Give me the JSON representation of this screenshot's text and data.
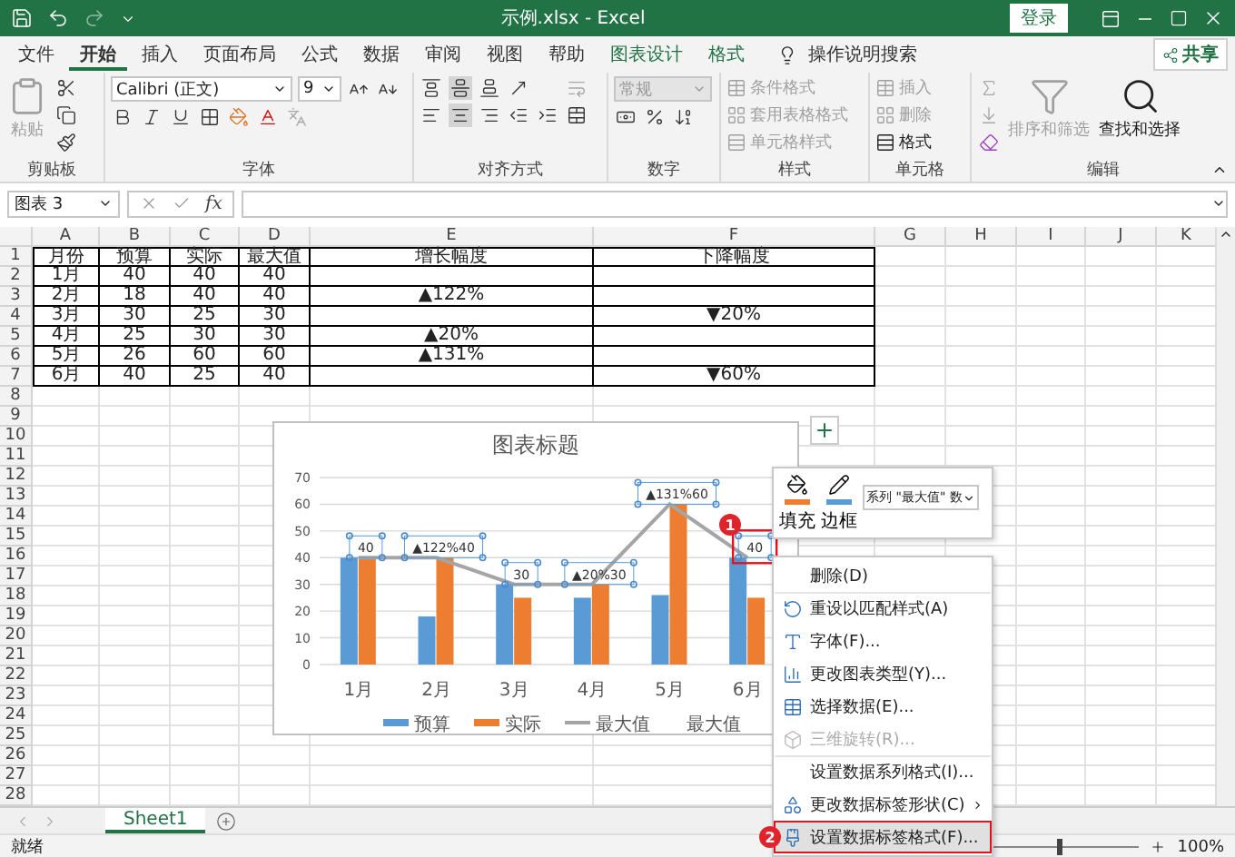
{
  "title_bar": {
    "title": "示例.xlsx - Excel",
    "login": "登录"
  },
  "menu_tabs": [
    {
      "label": "文件",
      "selected": false,
      "kind": "standard"
    },
    {
      "label": "开始",
      "selected": true,
      "kind": "standard"
    },
    {
      "label": "插入",
      "selected": false,
      "kind": "standard"
    },
    {
      "label": "页面布局",
      "selected": false,
      "kind": "standard"
    },
    {
      "label": "公式",
      "selected": false,
      "kind": "standard"
    },
    {
      "label": "数据",
      "selected": false,
      "kind": "standard"
    },
    {
      "label": "审阅",
      "selected": false,
      "kind": "standard"
    },
    {
      "label": "视图",
      "selected": false,
      "kind": "standard"
    },
    {
      "label": "帮助",
      "selected": false,
      "kind": "standard"
    },
    {
      "label": "图表设计",
      "selected": false,
      "kind": "contextual"
    },
    {
      "label": "格式",
      "selected": false,
      "kind": "contextual"
    }
  ],
  "tell_me": "操作说明搜索",
  "share": "共享",
  "ribbon": [
    {
      "label": "剪贴板",
      "kind": "clipboard",
      "paste": "粘贴"
    },
    {
      "label": "字体",
      "kind": "font",
      "font": "Calibri (正文)",
      "size": "9"
    },
    {
      "label": "对齐方式",
      "kind": "align"
    },
    {
      "label": "数字",
      "kind": "number",
      "format": "常规"
    },
    {
      "label": "样式",
      "kind": "list",
      "items": [
        {
          "label": "条件格式",
          "disabled": true
        },
        {
          "label": "套用表格格式",
          "disabled": true
        },
        {
          "label": "单元格样式",
          "disabled": true
        }
      ]
    },
    {
      "label": "单元格",
      "kind": "list",
      "items": [
        {
          "label": "插入",
          "disabled": true
        },
        {
          "label": "删除",
          "disabled": true
        },
        {
          "label": "格式",
          "disabled": false
        }
      ]
    },
    {
      "label": "编辑",
      "kind": "editing",
      "items": [
        {
          "label": "排序和筛选",
          "disabled": true
        },
        {
          "label": "查找和选择",
          "disabled": false
        }
      ]
    }
  ],
  "formula_bar": {
    "name_box": "图表 3",
    "function_label": "fx"
  },
  "sheet": {
    "columns": [
      "A",
      "B",
      "C",
      "D",
      "E",
      "F",
      "G",
      "H",
      "I",
      "J",
      "K"
    ],
    "row_numbers": [
      "1",
      "2",
      "3",
      "4",
      "5",
      "6",
      "7",
      "8",
      "9",
      "10",
      "11",
      "12",
      "13",
      "14",
      "15",
      "16",
      "17",
      "18",
      "19",
      "20",
      "21",
      "22",
      "23",
      "24",
      "25",
      "26",
      "27",
      "28"
    ],
    "rows": [
      {
        "cells": [
          {
            "text": "月份"
          },
          {
            "text": "预算"
          },
          {
            "text": "实际"
          },
          {
            "text": "最大值"
          },
          {
            "text": "增长幅度"
          },
          {
            "text": "下降幅度"
          }
        ]
      },
      {
        "cells": [
          {
            "text": "1月"
          },
          {
            "text": "40"
          },
          {
            "text": "40"
          },
          {
            "text": "40"
          },
          {},
          {}
        ]
      },
      {
        "cells": [
          {
            "text": "2月"
          },
          {
            "text": "18"
          },
          {
            "text": "40"
          },
          {
            "text": "40"
          },
          {
            "text": "▲122%"
          },
          {}
        ]
      },
      {
        "cells": [
          {
            "text": "3月"
          },
          {
            "text": "30"
          },
          {
            "text": "25"
          },
          {
            "text": "30"
          },
          {},
          {
            "text": "▼20%"
          }
        ]
      },
      {
        "cells": [
          {
            "text": "4月"
          },
          {
            "text": "25"
          },
          {
            "text": "30"
          },
          {
            "text": "30"
          },
          {
            "text": "▲20%"
          },
          {}
        ]
      },
      {
        "cells": [
          {
            "text": "5月"
          },
          {
            "text": "26"
          },
          {
            "text": "60"
          },
          {
            "text": "60"
          },
          {
            "text": "▲131%"
          },
          {}
        ]
      },
      {
        "cells": [
          {
            "text": "6月"
          },
          {
            "text": "40"
          },
          {
            "text": "25"
          },
          {
            "text": "40"
          },
          {},
          {
            "text": "▼60%"
          }
        ]
      }
    ]
  },
  "chart": {
    "chart_data": {
      "type": "bar",
      "title": "图表标题",
      "grid": true,
      "legend": true,
      "categories": [
        "1月",
        "2月",
        "3月",
        "4月",
        "5月",
        "6月"
      ],
      "ylim": [
        0,
        70
      ],
      "yticks": [
        {
          "value": 0,
          "label": "0"
        },
        {
          "value": 10,
          "label": "10"
        },
        {
          "value": 20,
          "label": "20"
        },
        {
          "value": 30,
          "label": "30"
        },
        {
          "value": 40,
          "label": "40"
        },
        {
          "value": 50,
          "label": "50"
        },
        {
          "value": 60,
          "label": "60"
        },
        {
          "value": 70,
          "label": "70"
        }
      ],
      "series": [
        {
          "name": "预算",
          "color": "#5b9bd5",
          "type": "bar",
          "values": [
            40,
            18,
            30,
            25,
            26,
            40
          ]
        },
        {
          "name": "实际",
          "color": "#ed7d31",
          "type": "bar",
          "values": [
            40,
            40,
            25,
            30,
            60,
            25
          ]
        },
        {
          "name": "最大值",
          "color": "#a5a5a5",
          "type": "line",
          "values": [
            40,
            40,
            30,
            30,
            60,
            40
          ]
        }
      ]
    },
    "point_labels": [
      {
        "text": "40",
        "highlighted": false
      },
      {
        "text": "▲122%40",
        "highlighted": false
      },
      {
        "text": "30",
        "highlighted": false
      },
      {
        "text": "▲20%30",
        "highlighted": false
      },
      {
        "text": "▲131%60",
        "highlighted": false
      },
      {
        "text": "40",
        "highlighted": true
      }
    ],
    "extra_legend": [
      "最大值"
    ]
  },
  "mini_toolbar": {
    "fill": "填充",
    "outline": "边框",
    "series_box": "系列 \"最大值\" 数"
  },
  "context_menu": [
    {
      "label": "删除(D)",
      "kind": "none",
      "disabled": false,
      "selected": false,
      "submenu": false
    },
    {
      "label": "重设以匹配样式(A)",
      "kind": "reset",
      "disabled": false,
      "selected": false,
      "submenu": false
    },
    {
      "label": "字体(F)...",
      "kind": "font",
      "disabled": false,
      "selected": false,
      "submenu": false
    },
    {
      "label": "更改图表类型(Y)...",
      "kind": "chart",
      "disabled": false,
      "selected": false,
      "submenu": false
    },
    {
      "label": "选择数据(E)...",
      "kind": "data",
      "disabled": false,
      "selected": false,
      "submenu": false
    },
    {
      "label": "三维旋转(R)...",
      "kind": "rotate",
      "disabled": true,
      "selected": false,
      "submenu": false
    },
    {
      "label": "设置数据系列格式(I)...",
      "kind": "none",
      "disabled": false,
      "selected": false,
      "submenu": false
    },
    {
      "label": "更改数据标签形状(C)",
      "kind": "shape",
      "disabled": false,
      "selected": false,
      "submenu": true
    },
    {
      "label": "设置数据标签格式(F)...",
      "kind": "format",
      "disabled": false,
      "selected": true,
      "submenu": false
    }
  ],
  "callouts": [
    "1",
    "2"
  ],
  "sheet_tabs": [
    {
      "label": "Sheet1",
      "selected": true
    }
  ],
  "status_bar": {
    "status": "就绪",
    "zoom": "100%",
    "zoom_slider": {
      "level": 0.5
    }
  }
}
